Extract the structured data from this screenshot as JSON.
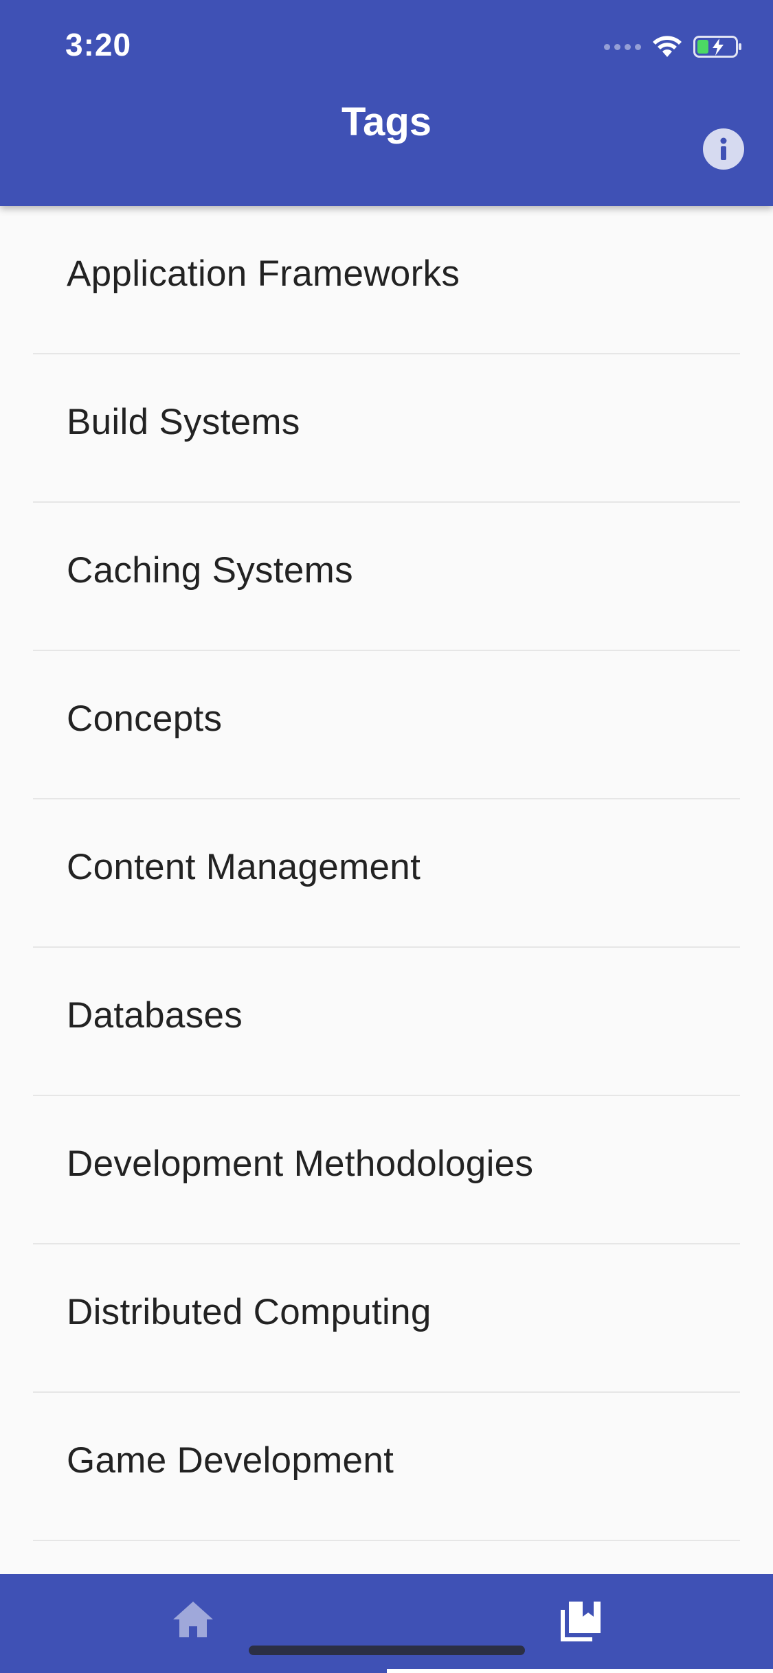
{
  "status_bar": {
    "time": "3:20"
  },
  "app_bar": {
    "title": "Tags",
    "info_icon": "info-icon"
  },
  "tags": [
    {
      "label": "Application Frameworks"
    },
    {
      "label": "Build Systems"
    },
    {
      "label": "Caching Systems"
    },
    {
      "label": "Concepts"
    },
    {
      "label": "Content Management"
    },
    {
      "label": "Databases"
    },
    {
      "label": "Development Methodologies"
    },
    {
      "label": "Distributed Computing"
    },
    {
      "label": "Game Development"
    }
  ],
  "bottom_nav": {
    "items": [
      {
        "icon": "home-icon",
        "selected": false
      },
      {
        "icon": "bookmarks-icon",
        "selected": true
      }
    ]
  },
  "colors": {
    "primary": "#3f51b5",
    "background": "#fafafa",
    "text": "#222222",
    "divider": "#e6e6e6",
    "inactive_icon": "#9fa8da",
    "battery_fill": "#4cd964"
  }
}
